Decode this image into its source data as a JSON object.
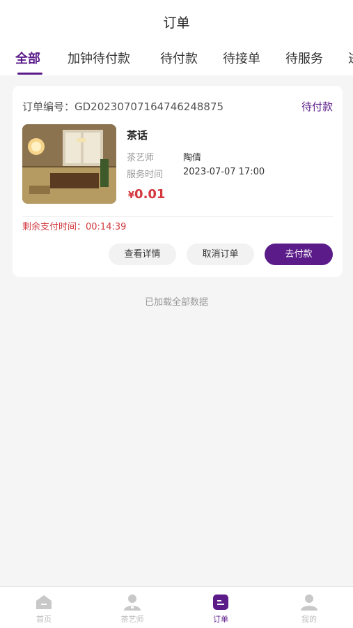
{
  "header": {
    "title": "订单"
  },
  "tabs": [
    {
      "label": "全部",
      "active": true
    },
    {
      "label": "加钟待付款"
    },
    {
      "label": "待付款"
    },
    {
      "label": "待接单"
    },
    {
      "label": "待服务"
    },
    {
      "label": "进"
    }
  ],
  "order": {
    "number": "订单编号：GD20230707164746248875",
    "status": "待付款",
    "image_alt": "tea-room-photo",
    "service_name": "茶话",
    "tea_artist_label": "茶艺师",
    "tea_artist_value": "陶倩",
    "service_time_label": "服务时间",
    "service_time_value": "2023-07-07 17:00",
    "price_currency": "¥",
    "price_value": "0.01",
    "countdown": "剩余支付时间：00:14:39",
    "buttons": {
      "detail": "查看详情",
      "cancel": "取消订单",
      "pay": "去付款"
    }
  },
  "list": {
    "end_text": "已加载全部数据"
  },
  "tabbar": [
    {
      "label": "首页",
      "icon": "home-icon"
    },
    {
      "label": "茶艺师",
      "icon": "tea-artist-icon"
    },
    {
      "label": "订单",
      "icon": "order-icon",
      "active": true
    },
    {
      "label": "我的",
      "icon": "profile-icon"
    }
  ],
  "colors": {
    "accent": "#5b1c8a",
    "price": "#d2383d",
    "background": "#f5f5f5"
  }
}
